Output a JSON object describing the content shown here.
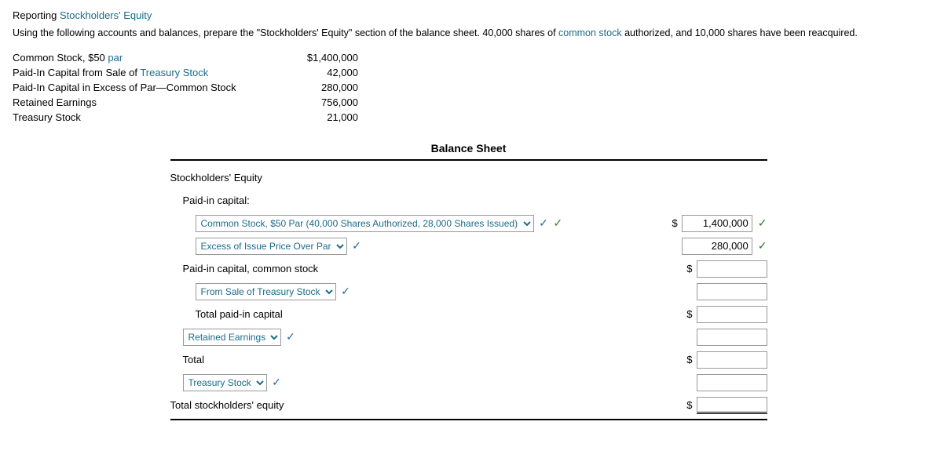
{
  "page": {
    "heading": {
      "prefix": "Reporting ",
      "link": "Stockholders' Equity"
    },
    "instruction": "Using the following accounts and balances, prepare the \"Stockholders' Equity\" section of the balance sheet. 40,000 shares of common stock authorized, and 10,000 shares have been reacquired.",
    "accounts": [
      {
        "label": "Common Stock, $50 ",
        "label_suffix": "par",
        "value": "$1,400,000",
        "blue_part": ""
      },
      {
        "label": "Paid-In Capital from Sale of ",
        "label_blue": "Treasury Stock",
        "value": "42,000"
      },
      {
        "label": "Paid-In Capital in Excess of Par—Common Stock",
        "value": "280,000"
      },
      {
        "label": "Retained Earnings",
        "value": "756,000"
      },
      {
        "label": "Treasury Stock",
        "value": "21,000"
      }
    ],
    "balance_sheet": {
      "title": "Balance Sheet",
      "sections": {
        "equity_header": "Stockholders' Equity",
        "paid_in_header": "Paid-in capital:",
        "common_stock_dropdown": "Common Stock, $50 Par (40,000 Shares Authorized, 28,000 Shares Issued)",
        "common_stock_value": "1,400,000",
        "excess_dropdown": "Excess of Issue Price Over Par",
        "excess_value": "280,000",
        "paid_in_common": "Paid-in capital, common stock",
        "from_sale_dropdown": "From Sale of Treasury Stock",
        "total_paid_in": "Total paid-in capital",
        "retained_earnings_dropdown": "Retained Earnings",
        "total_label": "Total",
        "treasury_dropdown": "Treasury Stock",
        "total_equity": "Total stockholders' equity"
      }
    }
  }
}
